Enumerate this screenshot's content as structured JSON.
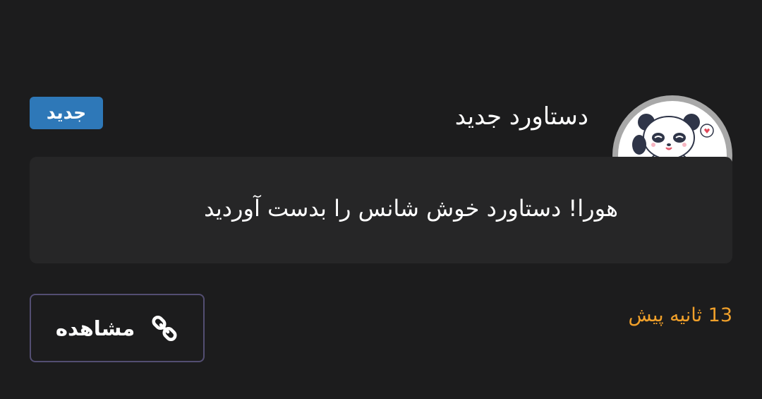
{
  "notification": {
    "title": "دستاورد جدید",
    "badge": "جدید",
    "message": "هورا! دستاورد خوش شانس را بدست آوردید",
    "timestamp": "13 ثانیه پیش",
    "view_button_label": "مشاهده",
    "avatar_icon": "lucky-panda-icon",
    "button_icon": "link-icon"
  },
  "colors": {
    "background": "#1c1c1d",
    "message_box": "#262627",
    "badge": "#2e78b8",
    "timestamp": "#f0a02a",
    "button_border": "#534e72",
    "avatar_ring": "#a8a8a8"
  }
}
